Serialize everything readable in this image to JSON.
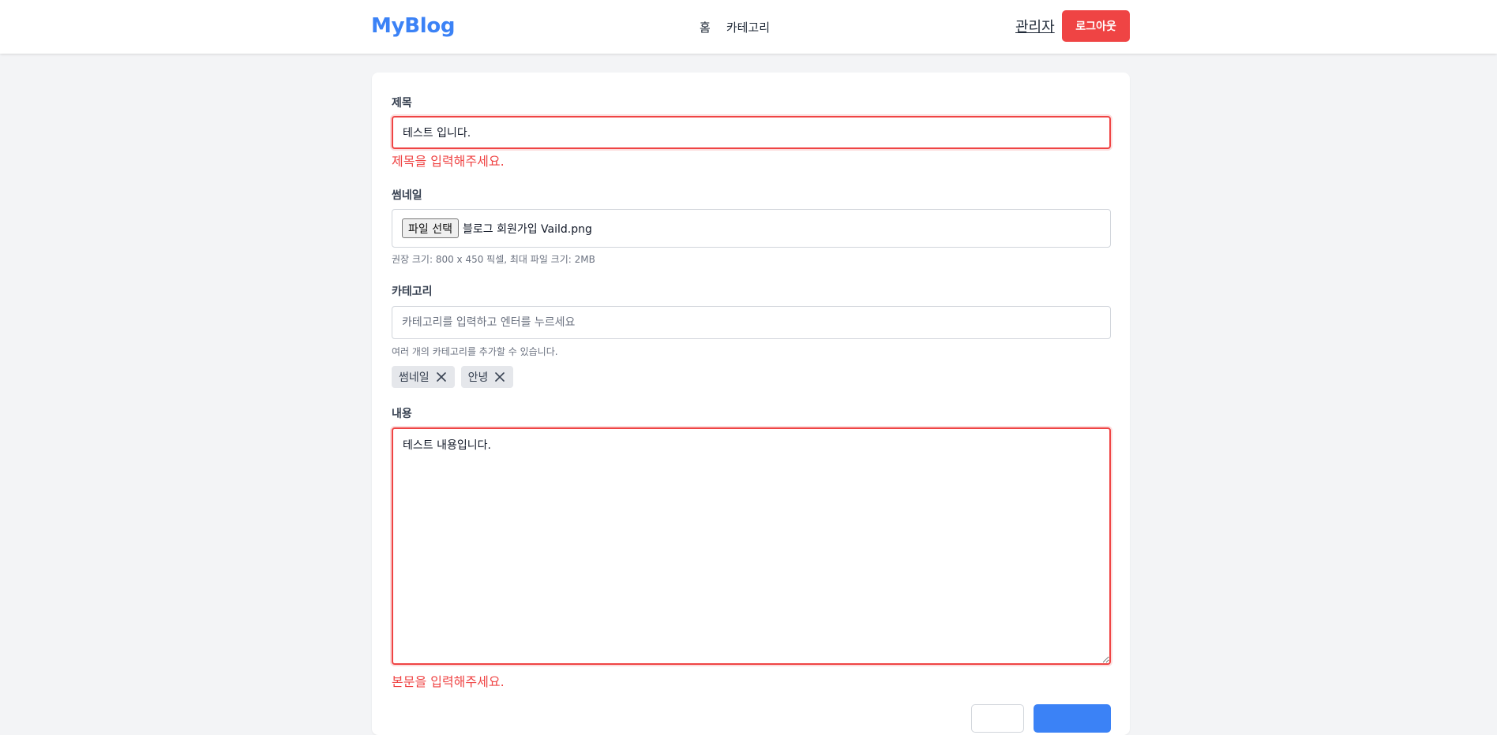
{
  "header": {
    "logo": "MyBlog",
    "nav": [
      {
        "label": "홈"
      },
      {
        "label": "카테고리"
      }
    ],
    "admin_label": "관리자",
    "logout_label": "로그아웃"
  },
  "form": {
    "title": {
      "label": "제목",
      "value": "테스트 입니다.",
      "error": "제목을 입력해주세요."
    },
    "thumbnail": {
      "label": "썸네일",
      "button_label": "파일 선택",
      "file_name": "블로그 회원가입 Vaild.png",
      "hint": "권장 크기: 800 x 450 픽셀, 최대 파일 크기: 2MB"
    },
    "category": {
      "label": "카테고리",
      "placeholder": "카테고리를 입력하고 엔터를 누르세요",
      "hint": "여러 개의 카테고리를 추가할 수 있습니다.",
      "tags": [
        {
          "label": "썸네일"
        },
        {
          "label": "안녕"
        }
      ]
    },
    "content": {
      "label": "내용",
      "value": "테스트 내용입니다.",
      "error": "본문을 입력해주세요."
    }
  },
  "colors": {
    "brand": "#3b82f6",
    "danger": "#ef4444"
  },
  "icons": {
    "tag_remove": "close-icon"
  }
}
